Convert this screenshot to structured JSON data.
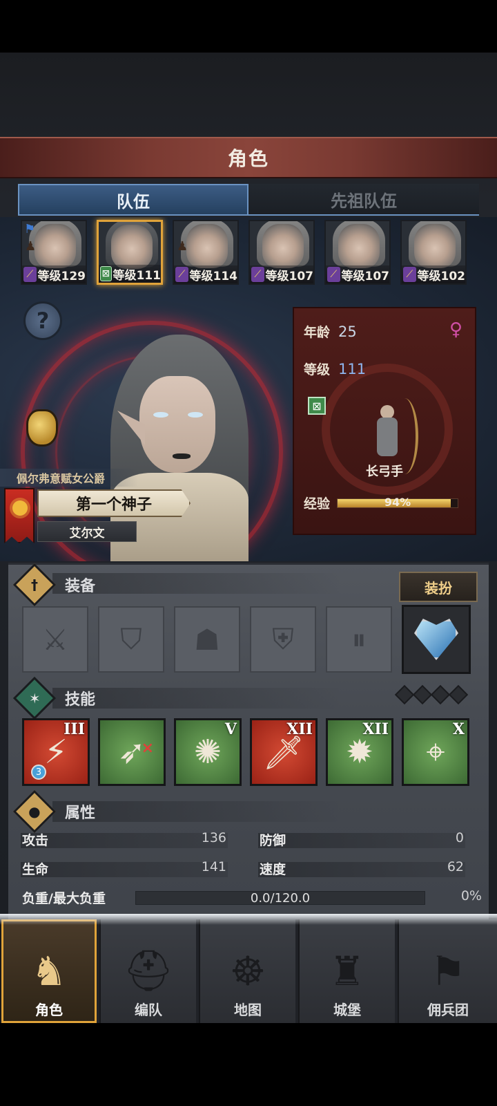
{
  "header": {
    "title": "角色"
  },
  "tabs": [
    {
      "label": "队伍",
      "active": true
    },
    {
      "label": "先祖队伍",
      "active": false
    }
  ],
  "roster": [
    {
      "level": "等级129",
      "class_icon": "staff-icon",
      "has_flag": true,
      "has_villager": true,
      "selected": false
    },
    {
      "level": "等级111",
      "class_icon": "bow-icon",
      "has_flag": false,
      "has_villager": false,
      "selected": true
    },
    {
      "level": "等级114",
      "class_icon": "staff-icon",
      "has_flag": false,
      "has_villager": true,
      "selected": false
    },
    {
      "level": "等级107",
      "class_icon": "staff-icon",
      "has_flag": false,
      "has_villager": false,
      "selected": false
    },
    {
      "level": "等级107",
      "class_icon": "staff-icon",
      "has_flag": false,
      "has_villager": false,
      "selected": false
    },
    {
      "level": "等级102",
      "class_icon": "staff-icon",
      "has_flag": false,
      "has_villager": false,
      "selected": false
    }
  ],
  "hero": {
    "noble_title": "佩尔弗意赋女公爵",
    "epithet": "第一个神子",
    "name": "艾尔文"
  },
  "stats": {
    "age_label": "年龄",
    "age": "25",
    "level_label": "等级",
    "level": "111",
    "class_name": "长弓手",
    "exp_label": "经验",
    "exp_text": "94%",
    "exp_fraction": 0.94
  },
  "equipment": {
    "title": "装备",
    "dress_button": "装扮",
    "slots": [
      "sword-icon",
      "shield-icon",
      "helmet-icon",
      "armor-icon",
      "boots-icon",
      "amulet-icon"
    ]
  },
  "skills": {
    "title": "技能",
    "items": [
      {
        "icon": "slash-skill-icon",
        "rank": "III",
        "color": "red",
        "badge": "3"
      },
      {
        "icon": "bow-shot-skill-icon",
        "rank": "",
        "color": "green"
      },
      {
        "icon": "burst-skill-icon",
        "rank": "V",
        "color": "green"
      },
      {
        "icon": "sword-skill-icon",
        "rank": "XII",
        "color": "red"
      },
      {
        "icon": "explosion-skill-icon",
        "rank": "XII",
        "color": "green"
      },
      {
        "icon": "target-skill-icon",
        "rank": "X",
        "color": "green"
      }
    ]
  },
  "attributes": {
    "title": "属性",
    "attack_label": "攻击",
    "attack": "136",
    "defense_label": "防御",
    "defense": "0",
    "hp_label": "生命",
    "hp": "141",
    "speed_label": "速度",
    "speed": "62",
    "load_label": "负重/最大负重",
    "load_text": "0.0/120.0",
    "load_pct": "0%"
  },
  "nav": [
    {
      "label": "角色",
      "icon": "knight-icon",
      "active": true
    },
    {
      "label": "编队",
      "icon": "helmet-icon",
      "active": false
    },
    {
      "label": "地图",
      "icon": "compass-map-icon",
      "active": false
    },
    {
      "label": "城堡",
      "icon": "castle-icon",
      "active": false
    },
    {
      "label": "佣兵团",
      "icon": "mercenary-icon",
      "active": false
    }
  ],
  "colors": {
    "accent_gold": "#e0a33a",
    "tab_blue": "#3c5c84",
    "level_blue": "#8fb6ef",
    "age_blue": "#c9d6e6",
    "gender_pink": "#d04fa6"
  }
}
